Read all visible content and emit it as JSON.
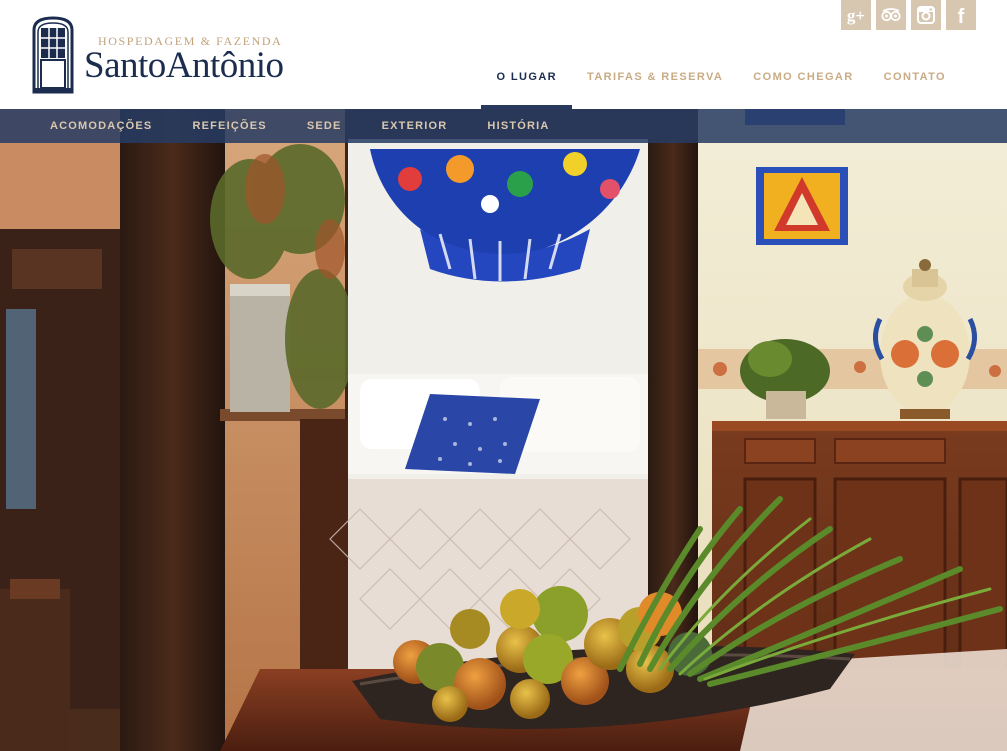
{
  "brand": {
    "tagline": "HOSPEDAGEM & FAZENDA",
    "name": "SantoAntônio",
    "logo_icon": "window-door-icon",
    "color_primary": "#1b2c4f",
    "color_accent": "#c9ab84"
  },
  "social": [
    {
      "name": "google-plus-icon",
      "glyph": "g+"
    },
    {
      "name": "tripadvisor-icon",
      "glyph": "owl"
    },
    {
      "name": "instagram-icon",
      "glyph": "camera"
    },
    {
      "name": "facebook-icon",
      "glyph": "f"
    }
  ],
  "main_nav": {
    "items": [
      {
        "label": "O LUGAR",
        "active": true
      },
      {
        "label": "TARIFAS & RESERVA",
        "active": false
      },
      {
        "label": "COMO CHEGAR",
        "active": false
      },
      {
        "label": "CONTATO",
        "active": false
      }
    ]
  },
  "sub_nav": {
    "items": [
      {
        "label": "ACOMODAÇÕES"
      },
      {
        "label": "REFEIÇÕES"
      },
      {
        "label": "SEDE"
      },
      {
        "label": "EXTERIOR"
      },
      {
        "label": "HISTÓRIA"
      }
    ]
  },
  "hero": {
    "image_subject": "guest-room-interior-photo"
  }
}
